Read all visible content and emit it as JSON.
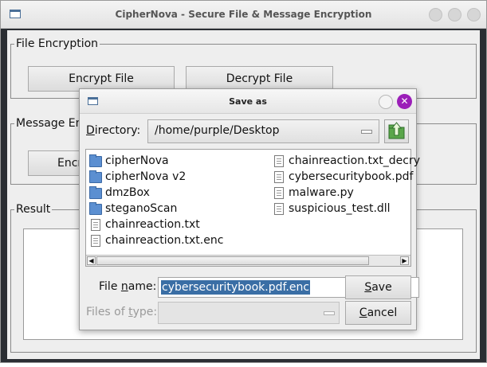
{
  "window": {
    "title": "CipherNova - Secure File & Message Encryption"
  },
  "file_encryption": {
    "legend": "File Encryption",
    "encrypt_label": "Encrypt File",
    "decrypt_label": "Decrypt File"
  },
  "message_encryption": {
    "legend": "Message En",
    "encrypt_label": "Encr"
  },
  "result": {
    "legend": "Result"
  },
  "dialog": {
    "title": "Save as",
    "directory_label_pre": "D",
    "directory_label_rest": "irectory:",
    "directory_value": "/home/purple/Desktop",
    "files_col1": [
      {
        "name": "cipherNova",
        "icon": "folder-icon"
      },
      {
        "name": "cipherNova v2",
        "icon": "folder-icon"
      },
      {
        "name": "dmzBox",
        "icon": "folder-icon"
      },
      {
        "name": "steganoScan",
        "icon": "folder-icon"
      },
      {
        "name": "chainreaction.txt",
        "icon": "file-icon"
      },
      {
        "name": "chainreaction.txt.enc",
        "icon": "file-icon"
      }
    ],
    "files_col2": [
      {
        "name": "chainreaction.txt_decry",
        "icon": "file-icon"
      },
      {
        "name": "cybersecuritybook.pdf",
        "icon": "file-icon"
      },
      {
        "name": "malware.py",
        "icon": "file-icon"
      },
      {
        "name": "suspicious_test.dll",
        "icon": "file-icon"
      }
    ],
    "filename_label_pre": "File ",
    "filename_label_u": "n",
    "filename_label_post": "ame:",
    "filename_value": "cybersecuritybook.pdf.enc",
    "filetype_label_pre": "Files of ",
    "filetype_label_u": "t",
    "filetype_label_post": "ype:",
    "save_label_u": "S",
    "save_label_rest": "ave",
    "cancel_label_u": "C",
    "cancel_label_rest": "ancel"
  },
  "colors": {
    "accent_selection": "#3a6ea5",
    "close_button": "#9b1fb8",
    "folder": "#5b8fd1"
  }
}
